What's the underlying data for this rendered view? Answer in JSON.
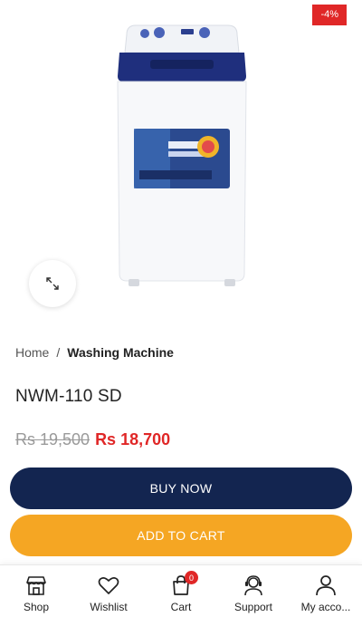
{
  "product": {
    "discount_badge": "-4%",
    "title": "NWM-110 SD",
    "old_price": "Rs 19,500",
    "new_price": "Rs 18,700"
  },
  "breadcrumb": {
    "home": "Home",
    "separator": "/",
    "current": "Washing Machine"
  },
  "actions": {
    "buy_now": "BUY NOW",
    "add_to_cart": "ADD TO CART"
  },
  "bottom_nav": {
    "items": [
      {
        "label": "Shop",
        "icon": "shop-icon"
      },
      {
        "label": "Wishlist",
        "icon": "heart-icon"
      },
      {
        "label": "Cart",
        "icon": "cart-icon",
        "count": "0"
      },
      {
        "label": "Support",
        "icon": "support-agent-icon"
      },
      {
        "label": "My acco...",
        "icon": "user-icon"
      }
    ]
  },
  "colors": {
    "accent_red": "#e02727",
    "navy": "#132550",
    "orange": "#f5a623"
  }
}
